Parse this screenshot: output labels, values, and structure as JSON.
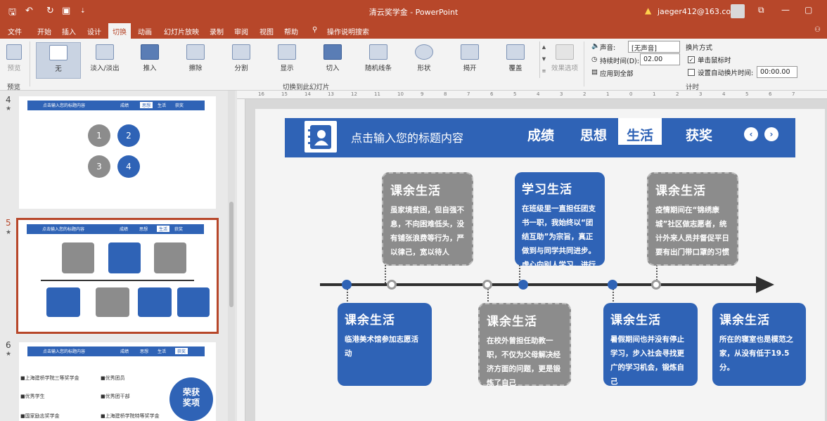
{
  "window": {
    "title": "清云奖学金 - PowerPoint",
    "account": "jaeger412@163.com"
  },
  "tabs": [
    "文件",
    "开始",
    "插入",
    "设计",
    "切换",
    "动画",
    "幻灯片放映",
    "录制",
    "审阅",
    "视图",
    "帮助",
    "操作说明搜索"
  ],
  "active_tab": "切换",
  "ribbon": {
    "preview": "预览",
    "preview_group": "预览",
    "transitions": [
      "无",
      "淡入/淡出",
      "推入",
      "擦除",
      "分割",
      "显示",
      "切入",
      "随机线条",
      "形状",
      "揭开",
      "覆盖"
    ],
    "effect_options": "效果选项",
    "transitions_group": "切换到此幻灯片",
    "sound_label": "声音:",
    "sound_value": "[无声音]",
    "duration_label": "持续时间(D):",
    "duration_value": "02.00",
    "apply_all": "应用到全部",
    "advance_header": "换片方式",
    "on_click": "单击鼠标时",
    "after_time": "设置自动换片时间:",
    "after_value": "00:00.00",
    "timing_group": "计时"
  },
  "ruler_marks": [
    "16",
    "15",
    "14",
    "13",
    "12",
    "11",
    "10",
    "9",
    "8",
    "7",
    "6",
    "5",
    "4",
    "3",
    "2",
    "1",
    "0",
    "1",
    "2",
    "3",
    "4",
    "5",
    "6",
    "7"
  ],
  "slides_panel": {
    "slides": [
      {
        "number": "4",
        "star": "★"
      },
      {
        "number": "5",
        "star": "★"
      },
      {
        "number": "6",
        "star": "★"
      }
    ],
    "thumb_tabs": [
      "点击输入您的标题内容",
      "成绩",
      "思想",
      "生活",
      "获奖"
    ],
    "s4_circles": [
      "1",
      "2",
      "3",
      "4"
    ],
    "s6_badge": "荣获\n奖项",
    "s6_items": [
      "■上海建桥学院三等奖学金",
      "■优秀团员",
      "■优秀学生",
      "■优秀团干部",
      "■国家励志奖学金",
      "■上海建桥学院特等奖学金"
    ]
  },
  "slide": {
    "header": {
      "title": "点击输入您的标题内容",
      "tabs": [
        "成绩",
        "思想",
        "生活",
        "获奖"
      ],
      "active": "生活",
      "prev": "‹",
      "next": "›"
    },
    "cards_top": [
      {
        "title": "课余生活",
        "text": "虽家境贫困，但自强不息，不向困难低头，没有铺张浪费等行为，严以律己，宽以待人",
        "style": "grey"
      },
      {
        "title": "学习生活",
        "text": "在班级里一直担任团支书一职，我始终以“团结互助”为宗旨，真正做到与同学共同进步。虚心向别人学习，进行批评与自我批评，做好力所能及",
        "style": "blue"
      },
      {
        "title": "课余生活",
        "text": "疫情期间在“锦绣康城”社区做志愿者，统计外来人员并督促平日要有出门带口罩的习惯",
        "style": "grey"
      }
    ],
    "cards_bottom": [
      {
        "title": "课余生活",
        "text": "临港美术馆参加志愿活动",
        "style": "blue"
      },
      {
        "title": "课余生活",
        "text": "在校外曾担任助教一职，不仅为父母解决经济方面的问题，更是锻炼了自己",
        "style": "grey"
      },
      {
        "title": "课余生活",
        "text": "暑假期间也并没有停止学习，步入社会寻找更广的学习机会，锻炼自己",
        "style": "blue"
      },
      {
        "title": "课余生活",
        "text": "所在的寝室也是模范之家，从没有低于19.5分。",
        "style": "blue"
      }
    ]
  },
  "colors": {
    "accent": "#b7472a",
    "slide_blue": "#2f63b6",
    "grey_card": "#8c8c8c"
  }
}
